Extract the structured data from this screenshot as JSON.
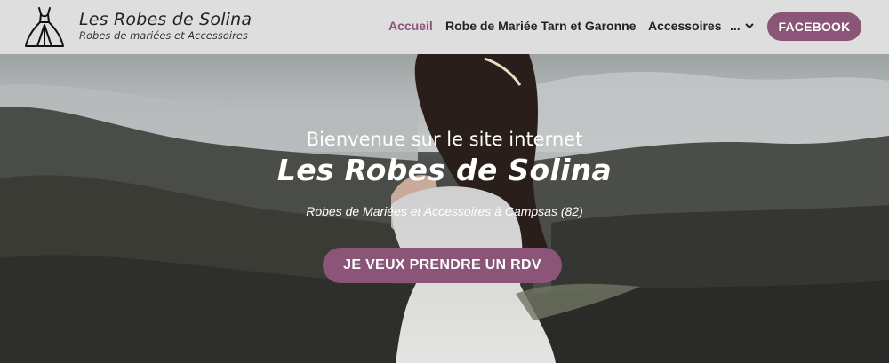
{
  "header": {
    "brand_title": "Les Robes de Solina",
    "brand_subtitle": "Robes de mariées et Accessoires",
    "nav": [
      {
        "label": "Accueil",
        "active": true
      },
      {
        "label": "Robe de Mariée Tarn et Garonne",
        "active": false
      },
      {
        "label": "Accessoires",
        "active": false
      },
      {
        "label": "...",
        "active": false
      }
    ],
    "facebook_label": "FACEBOOK"
  },
  "hero": {
    "welcome": "Bienvenue sur le site internet",
    "title": "Les Robes de Solina",
    "subtitle": "Robes de Mariées et Accessoires à Campsas (82)",
    "cta_label": "JE VEUX PRENDRE UN RDV"
  },
  "colors": {
    "accent": "#8a5577",
    "header_bg": "#dedede"
  },
  "icons": {
    "logo": "wedding-dress-icon",
    "more": "chevron-down-icon"
  }
}
